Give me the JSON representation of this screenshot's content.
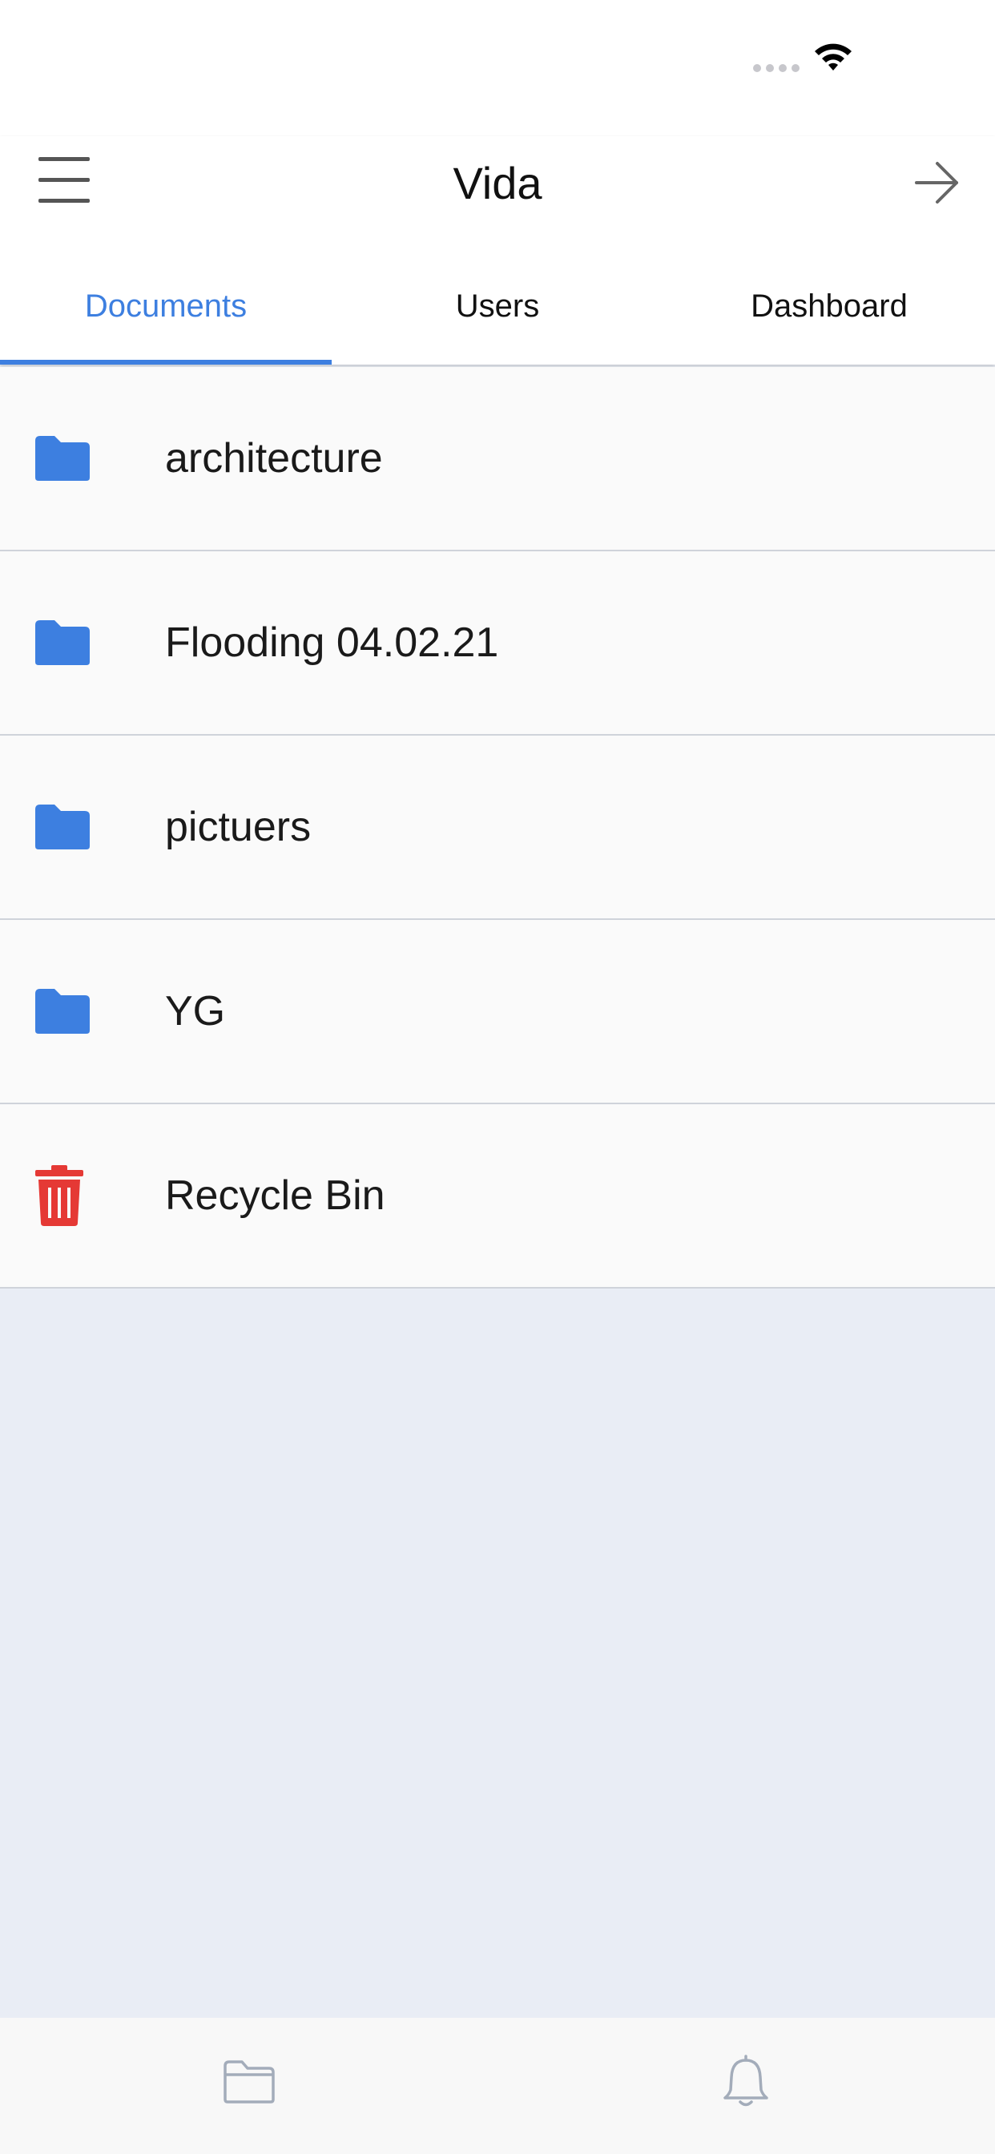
{
  "header": {
    "title": "Vida"
  },
  "tabs": [
    {
      "label": "Documents",
      "active": true
    },
    {
      "label": "Users",
      "active": false
    },
    {
      "label": "Dashboard",
      "active": false
    }
  ],
  "items": [
    {
      "label": "architecture",
      "icon": "folder-icon"
    },
    {
      "label": "Flooding 04.02.21",
      "icon": "folder-icon"
    },
    {
      "label": "pictuers",
      "icon": "folder-icon"
    },
    {
      "label": "YG",
      "icon": "folder-icon"
    },
    {
      "label": "Recycle Bin",
      "icon": "trash-icon"
    }
  ],
  "bottom_nav": [
    {
      "icon": "folder-outline-icon"
    },
    {
      "icon": "bell-icon"
    }
  ],
  "colors": {
    "accent": "#3d7fe0",
    "folder": "#3d7fe0",
    "trash": "#e53935",
    "background": "#e9edf5"
  }
}
